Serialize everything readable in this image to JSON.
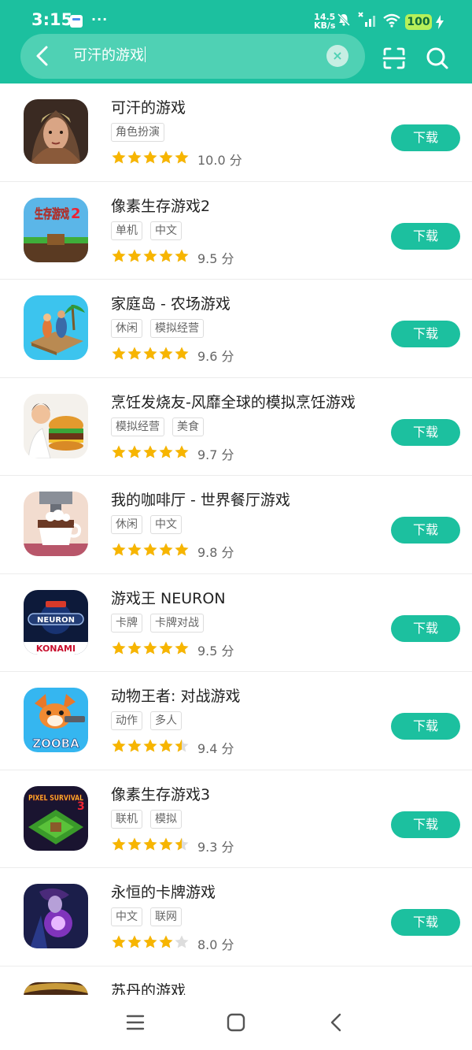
{
  "status_bar": {
    "time": "3:15",
    "dots": "···",
    "speed_value": "14.5",
    "speed_unit": "KB/s",
    "battery": "100"
  },
  "search": {
    "query": "可汗的游戏",
    "clear_label": "×"
  },
  "colors": {
    "accent": "#1cc09f",
    "star": "#f7b500",
    "star_empty": "#dddddd"
  },
  "apps": [
    {
      "name": "可汗的游戏",
      "tags": [
        "角色扮演"
      ],
      "rating": 5,
      "score": "10.0 分",
      "button": "下载",
      "icon": "warrior-portrait-icon"
    },
    {
      "name": "像素生存游戏2",
      "tags": [
        "单机",
        "中文"
      ],
      "rating": 5,
      "score": "9.5 分",
      "button": "下载",
      "icon": "pixel-survival-2-icon",
      "icon_text": "生存游戏"
    },
    {
      "name": "家庭岛 - 农场游戏",
      "tags": [
        "休闲",
        "模拟经营"
      ],
      "rating": 5,
      "score": "9.6 分",
      "button": "下载",
      "icon": "island-raft-icon"
    },
    {
      "name": "烹饪发烧友-风靡全球的模拟烹饪游戏",
      "tags": [
        "模拟经营",
        "美食"
      ],
      "rating": 5,
      "score": "9.7 分",
      "button": "下载",
      "icon": "chef-burger-icon"
    },
    {
      "name": "我的咖啡厅 - 世界餐厅游戏",
      "tags": [
        "休闲",
        "中文"
      ],
      "rating": 5,
      "score": "9.8 分",
      "button": "下载",
      "icon": "coffee-cup-icon"
    },
    {
      "name": "游戏王 NEURON",
      "tags": [
        "卡牌",
        "卡牌对战"
      ],
      "rating": 5,
      "score": "9.5 分",
      "button": "下载",
      "icon": "yugioh-neuron-icon",
      "icon_text": "NEURON",
      "icon_subtext": "KONAMI"
    },
    {
      "name": "动物王者: 对战游戏",
      "tags": [
        "动作",
        "多人"
      ],
      "rating": 4.5,
      "score": "9.4 分",
      "button": "下载",
      "icon": "zooba-fox-icon",
      "icon_text": "ZOOBA"
    },
    {
      "name": "像素生存游戏3",
      "tags": [
        "联机",
        "模拟"
      ],
      "rating": 4.5,
      "score": "9.3 分",
      "button": "下载",
      "icon": "pixel-survival-3-icon",
      "icon_text": "PIXEL SURVIVAL"
    },
    {
      "name": "永恒的卡牌游戏",
      "tags": [
        "中文",
        "联网"
      ],
      "rating": 4,
      "score": "8.0 分",
      "button": "下载",
      "icon": "eternal-card-icon"
    },
    {
      "name": "苏丹的游戏",
      "tags": [],
      "rating": 0,
      "score": "",
      "button": "",
      "icon": "sultan-icon"
    }
  ]
}
